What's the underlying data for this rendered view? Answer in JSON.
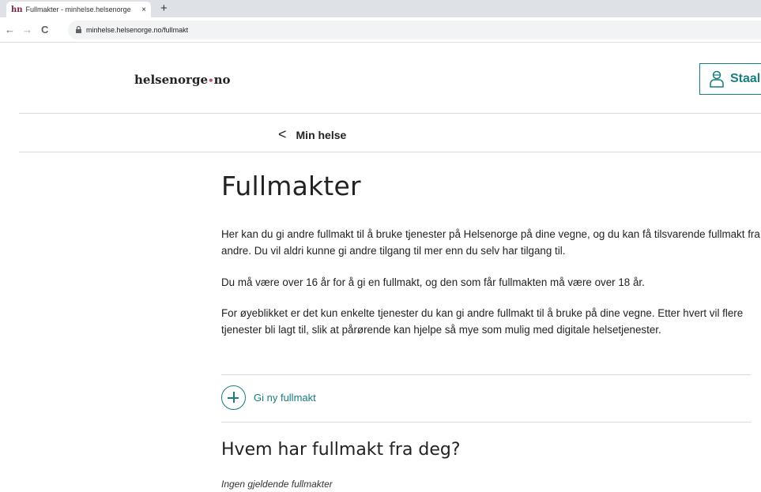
{
  "browser": {
    "favicon": "hn",
    "tab_title": "Fullmakter - minhelse.helsenorge",
    "tab_close": "×",
    "new_tab": "+",
    "back": "←",
    "forward": "→",
    "reload": "C",
    "url": "minhelse.helsenorge.no/fullmakt"
  },
  "header": {
    "logo_text": "helsenorge",
    "logo_dot": "•",
    "logo_tld": "no",
    "user_name": "Staal"
  },
  "breadcrumb": {
    "chevron": "<",
    "label": "Min helse"
  },
  "main": {
    "title": "Fullmakter",
    "paragraphs": [
      "Her kan du gi andre fullmakt til å bruke tjenester på Helsenorge på dine vegne, og du kan få tilsvarende fullmakt fra andre. Du vil aldri kunne gi andre tilgang til mer enn du selv har tilgang til.",
      "Du må være over 16 år for å gi en fullmakt, og den som får fullmakten må være over 18 år.",
      "For øyeblikket er det kun enkelte tjenester du kan gi andre fullmakt til å bruke på dine vegne. Etter hvert vil flere tjenester bli lagt til, slik at pårørende kan hjelpe så mye som mulig med digitale helsetjenester."
    ],
    "add_link": "Gi ny fullmakt",
    "section_title": "Hvem har fullmakt fra deg?",
    "empty_text": "Ingen gjeldende fullmakter"
  },
  "colors": {
    "accent": "#167d80",
    "logo_dot": "#c5505f",
    "divider": "#d9d9d9"
  },
  "icons": {
    "user": "user-icon",
    "add": "plus-circle-icon",
    "back": "chevron-left-icon",
    "lock": "lock-icon"
  }
}
